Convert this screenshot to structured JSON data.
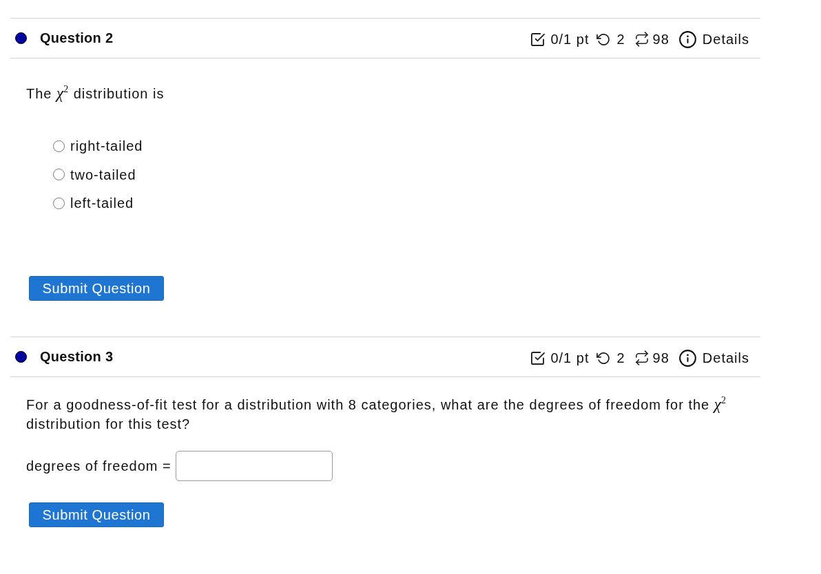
{
  "questions": [
    {
      "kind": "multiple_choice",
      "title": "Question 2",
      "color": "#0000a0",
      "score": "0/1 pt",
      "attempts": "2",
      "retries": "98",
      "details": "Details",
      "prompt": "The *χ*$^{2}$ distribution is",
      "options": [
        {
          "label": "right-tailed",
          "selected": false
        },
        {
          "label": "two-tailed",
          "selected": false
        },
        {
          "label": "left-tailed",
          "selected": false
        }
      ],
      "submit": "Submit Question"
    },
    {
      "kind": "numeric_entry",
      "title": "Question 3",
      "color": "#0000a0",
      "score": "0/1 pt",
      "attempts": "2",
      "retries": "98",
      "details": "Details",
      "prompt": "For a goodness-of-fit test for a distribution with 8 categories, what are the degrees of freedom for the *χ*$^{2}$ distribution for this test?",
      "field_label": "degrees of freedom =",
      "submit": "Submit Question"
    }
  ]
}
